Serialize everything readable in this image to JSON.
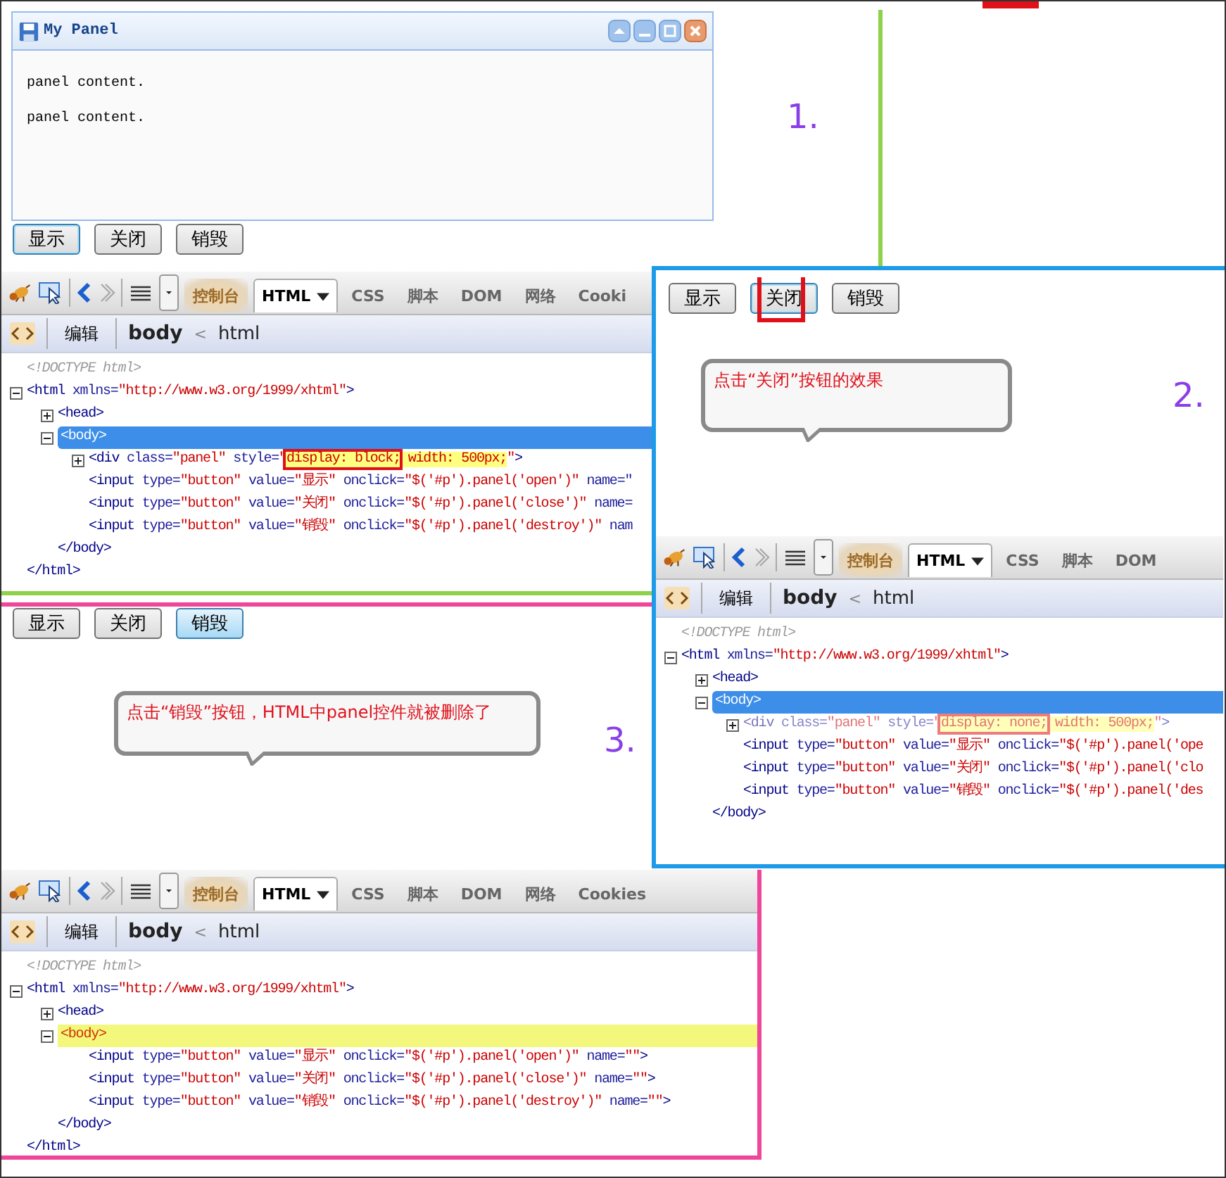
{
  "scenes": [
    {
      "panel": {
        "title": "My Panel",
        "paragraphs": [
          "panel content.",
          "panel content."
        ]
      },
      "buttons": [
        {
          "label": "显示",
          "focused": true,
          "pressed": false,
          "annotated": false
        },
        {
          "label": "关闭",
          "focused": false,
          "pressed": false,
          "annotated": false
        },
        {
          "label": "销毁",
          "focused": false,
          "pressed": false,
          "annotated": false
        }
      ],
      "step": "1.",
      "devtools": {
        "tabs": [
          {
            "label": "控制台",
            "selected": false,
            "glow": true
          },
          {
            "label": "HTML",
            "selected": true,
            "glow": false
          },
          {
            "label": "CSS",
            "selected": false,
            "glow": false
          },
          {
            "label": "脚本",
            "selected": false,
            "glow": false
          },
          {
            "label": "DOM",
            "selected": false,
            "glow": false
          },
          {
            "label": "网络",
            "selected": false,
            "glow": false
          },
          {
            "label": "Cooki",
            "selected": false,
            "glow": false
          }
        ],
        "edit_button": "编辑",
        "crumbs": [
          "body",
          "html"
        ],
        "separator": "<",
        "tree": [
          {
            "tokens": [
              {
                "kind": "comment",
                "text": "<!DOCTYPE html>"
              }
            ],
            "kind": "leaf",
            "selected": false,
            "changed": false,
            "dimmed": false
          },
          {
            "tokens": [
              {
                "kind": "tag",
                "text": "<html "
              },
              {
                "kind": "attr",
                "text": "xmlns="
              },
              {
                "kind": "value",
                "text": "\"http://www.w3.org/1999/xhtml\""
              },
              {
                "kind": "tag",
                "text": ">"
              }
            ],
            "kind": "expanded",
            "selected": false,
            "changed": false,
            "dimmed": false,
            "close": [
              {
                "kind": "tag",
                "text": "</html>"
              }
            ],
            "children": [
              {
                "tokens": [
                  {
                    "kind": "tag",
                    "text": "<head>"
                  }
                ],
                "kind": "collapsed",
                "selected": false,
                "changed": false,
                "dimmed": false
              },
              {
                "tokens": [
                  {
                    "kind": "tag",
                    "text": "<body>"
                  }
                ],
                "kind": "expanded",
                "selected": true,
                "changed": false,
                "dimmed": false,
                "close": [
                  {
                    "kind": "tag",
                    "text": "</body>"
                  }
                ],
                "children": [
                  {
                    "tokens": [
                      {
                        "kind": "tag",
                        "text": "<div "
                      },
                      {
                        "kind": "attr",
                        "text": "class="
                      },
                      {
                        "kind": "value",
                        "text": "\"panel\""
                      },
                      {
                        "kind": "attr",
                        "text": " style="
                      },
                      {
                        "kind": "value",
                        "text": "\""
                      },
                      {
                        "kind": "style-boxed",
                        "text": "display: block;"
                      },
                      {
                        "kind": "style",
                        "text": " width: 500px;"
                      },
                      {
                        "kind": "value",
                        "text": "\""
                      },
                      {
                        "kind": "tag",
                        "text": ">"
                      }
                    ],
                    "kind": "collapsed",
                    "selected": false,
                    "changed": false,
                    "dimmed": false
                  },
                  {
                    "tokens": [
                      {
                        "kind": "tag",
                        "text": "<input "
                      },
                      {
                        "kind": "attr",
                        "text": "type="
                      },
                      {
                        "kind": "value",
                        "text": "\"button\""
                      },
                      {
                        "kind": "attr",
                        "text": " value="
                      },
                      {
                        "kind": "value",
                        "text": "\"显示\""
                      },
                      {
                        "kind": "attr",
                        "text": " onclick="
                      },
                      {
                        "kind": "value",
                        "text": "\"$('#p').panel('open')\""
                      },
                      {
                        "kind": "attr",
                        "text": " name=\""
                      }
                    ],
                    "kind": "leaf",
                    "selected": false,
                    "changed": false,
                    "dimmed": false
                  },
                  {
                    "tokens": [
                      {
                        "kind": "tag",
                        "text": "<input "
                      },
                      {
                        "kind": "attr",
                        "text": "type="
                      },
                      {
                        "kind": "value",
                        "text": "\"button\""
                      },
                      {
                        "kind": "attr",
                        "text": " value="
                      },
                      {
                        "kind": "value",
                        "text": "\"关闭\""
                      },
                      {
                        "kind": "attr",
                        "text": " onclick="
                      },
                      {
                        "kind": "value",
                        "text": "\"$('#p').panel('close')\""
                      },
                      {
                        "kind": "attr",
                        "text": " name="
                      }
                    ],
                    "kind": "leaf",
                    "selected": false,
                    "changed": false,
                    "dimmed": false
                  },
                  {
                    "tokens": [
                      {
                        "kind": "tag",
                        "text": "<input "
                      },
                      {
                        "kind": "attr",
                        "text": "type="
                      },
                      {
                        "kind": "value",
                        "text": "\"button\""
                      },
                      {
                        "kind": "attr",
                        "text": " value="
                      },
                      {
                        "kind": "value",
                        "text": "\"销毁\""
                      },
                      {
                        "kind": "attr",
                        "text": " onclick="
                      },
                      {
                        "kind": "value",
                        "text": "\"$('#p').panel('destroy')\""
                      },
                      {
                        "kind": "attr",
                        "text": " nam"
                      }
                    ],
                    "kind": "leaf",
                    "selected": false,
                    "changed": false,
                    "dimmed": false
                  }
                ]
              }
            ]
          }
        ]
      }
    },
    {
      "buttons": [
        {
          "label": "显示",
          "focused": false,
          "pressed": false,
          "annotated": false
        },
        {
          "label": "关闭",
          "focused": true,
          "pressed": false,
          "annotated": true
        },
        {
          "label": "销毁",
          "focused": false,
          "pressed": false,
          "annotated": false
        }
      ],
      "callout": "点击“关闭”按钮的效果",
      "step": "2.",
      "devtools": {
        "tabs": [
          {
            "label": "控制台",
            "selected": false,
            "glow": true
          },
          {
            "label": "HTML",
            "selected": true,
            "glow": false
          },
          {
            "label": "CSS",
            "selected": false,
            "glow": false
          },
          {
            "label": "脚本",
            "selected": false,
            "glow": false
          },
          {
            "label": "DOM",
            "selected": false,
            "glow": false
          }
        ],
        "edit_button": "编辑",
        "crumbs": [
          "body",
          "html"
        ],
        "separator": "<",
        "tree": [
          {
            "tokens": [
              {
                "kind": "comment",
                "text": "<!DOCTYPE html>"
              }
            ],
            "kind": "leaf",
            "selected": false,
            "changed": false,
            "dimmed": false
          },
          {
            "tokens": [
              {
                "kind": "tag",
                "text": "<html "
              },
              {
                "kind": "attr",
                "text": "xmlns="
              },
              {
                "kind": "value",
                "text": "\"http://www.w3.org/1999/xhtml\""
              },
              {
                "kind": "tag",
                "text": ">"
              }
            ],
            "kind": "expanded",
            "selected": false,
            "changed": false,
            "dimmed": false,
            "children": [
              {
                "tokens": [
                  {
                    "kind": "tag",
                    "text": "<head>"
                  }
                ],
                "kind": "collapsed",
                "selected": false,
                "changed": false,
                "dimmed": false
              },
              {
                "tokens": [
                  {
                    "kind": "tag",
                    "text": "<body>"
                  }
                ],
                "kind": "expanded",
                "selected": true,
                "changed": false,
                "dimmed": false,
                "close": [
                  {
                    "kind": "tag",
                    "text": "</body>"
                  }
                ],
                "children": [
                  {
                    "tokens": [
                      {
                        "kind": "tag",
                        "text": "<div "
                      },
                      {
                        "kind": "attr",
                        "text": "class="
                      },
                      {
                        "kind": "value",
                        "text": "\"panel\""
                      },
                      {
                        "kind": "attr",
                        "text": " style="
                      },
                      {
                        "kind": "value",
                        "text": "\""
                      },
                      {
                        "kind": "style-boxed",
                        "text": "display: none;"
                      },
                      {
                        "kind": "style",
                        "text": " width: 500px;"
                      },
                      {
                        "kind": "value",
                        "text": "\""
                      },
                      {
                        "kind": "tag",
                        "text": ">"
                      }
                    ],
                    "kind": "collapsed",
                    "selected": false,
                    "changed": false,
                    "dimmed": true
                  },
                  {
                    "tokens": [
                      {
                        "kind": "tag",
                        "text": "<input "
                      },
                      {
                        "kind": "attr",
                        "text": "type="
                      },
                      {
                        "kind": "value",
                        "text": "\"button\""
                      },
                      {
                        "kind": "attr",
                        "text": " value="
                      },
                      {
                        "kind": "value",
                        "text": "\"显示\""
                      },
                      {
                        "kind": "attr",
                        "text": " onclick="
                      },
                      {
                        "kind": "value",
                        "text": "\"$('#p').panel('ope"
                      }
                    ],
                    "kind": "leaf",
                    "selected": false,
                    "changed": false,
                    "dimmed": false
                  },
                  {
                    "tokens": [
                      {
                        "kind": "tag",
                        "text": "<input "
                      },
                      {
                        "kind": "attr",
                        "text": "type="
                      },
                      {
                        "kind": "value",
                        "text": "\"button\""
                      },
                      {
                        "kind": "attr",
                        "text": " value="
                      },
                      {
                        "kind": "value",
                        "text": "\"关闭\""
                      },
                      {
                        "kind": "attr",
                        "text": " onclick="
                      },
                      {
                        "kind": "value",
                        "text": "\"$('#p').panel('clo"
                      }
                    ],
                    "kind": "leaf",
                    "selected": false,
                    "changed": false,
                    "dimmed": false
                  },
                  {
                    "tokens": [
                      {
                        "kind": "tag",
                        "text": "<input "
                      },
                      {
                        "kind": "attr",
                        "text": "type="
                      },
                      {
                        "kind": "value",
                        "text": "\"button\""
                      },
                      {
                        "kind": "attr",
                        "text": " value="
                      },
                      {
                        "kind": "value",
                        "text": "\"销毁\""
                      },
                      {
                        "kind": "attr",
                        "text": " onclick="
                      },
                      {
                        "kind": "value",
                        "text": "\"$('#p').panel('des"
                      }
                    ],
                    "kind": "leaf",
                    "selected": false,
                    "changed": false,
                    "dimmed": false
                  }
                ]
              }
            ]
          }
        ]
      }
    },
    {
      "buttons": [
        {
          "label": "显示",
          "focused": false,
          "pressed": false,
          "annotated": false
        },
        {
          "label": "关闭",
          "focused": false,
          "pressed": false,
          "annotated": false
        },
        {
          "label": "销毁",
          "focused": false,
          "pressed": true,
          "annotated": false
        }
      ],
      "callout": "点击“销毁”按钮，HTML中panel控件就被删除了",
      "step": "3.",
      "devtools": {
        "tabs": [
          {
            "label": "控制台",
            "selected": false,
            "glow": true
          },
          {
            "label": "HTML",
            "selected": true,
            "glow": false
          },
          {
            "label": "CSS",
            "selected": false,
            "glow": false
          },
          {
            "label": "脚本",
            "selected": false,
            "glow": false
          },
          {
            "label": "DOM",
            "selected": false,
            "glow": false
          },
          {
            "label": "网络",
            "selected": false,
            "glow": false
          },
          {
            "label": "Cookies",
            "selected": false,
            "glow": false
          }
        ],
        "edit_button": "编辑",
        "crumbs": [
          "body",
          "html"
        ],
        "separator": "<",
        "tree": [
          {
            "tokens": [
              {
                "kind": "comment",
                "text": "<!DOCTYPE html>"
              }
            ],
            "kind": "leaf",
            "selected": false,
            "changed": false,
            "dimmed": false
          },
          {
            "tokens": [
              {
                "kind": "tag",
                "text": "<html "
              },
              {
                "kind": "attr",
                "text": "xmlns="
              },
              {
                "kind": "value",
                "text": "\"http://www.w3.org/1999/xhtml\""
              },
              {
                "kind": "tag",
                "text": ">"
              }
            ],
            "kind": "expanded",
            "selected": false,
            "changed": false,
            "dimmed": false,
            "close": [
              {
                "kind": "tag",
                "text": "</html>"
              }
            ],
            "children": [
              {
                "tokens": [
                  {
                    "kind": "tag",
                    "text": "<head>"
                  }
                ],
                "kind": "collapsed",
                "selected": false,
                "changed": false,
                "dimmed": false
              },
              {
                "tokens": [
                  {
                    "kind": "tag",
                    "text": "<body>"
                  }
                ],
                "kind": "expanded",
                "selected": false,
                "changed": true,
                "dimmed": false,
                "close": [
                  {
                    "kind": "tag",
                    "text": "</body>"
                  }
                ],
                "children": [
                  {
                    "tokens": [
                      {
                        "kind": "tag",
                        "text": "<input "
                      },
                      {
                        "kind": "attr",
                        "text": "type="
                      },
                      {
                        "kind": "value",
                        "text": "\"button\""
                      },
                      {
                        "kind": "attr",
                        "text": " value="
                      },
                      {
                        "kind": "value",
                        "text": "\"显示\""
                      },
                      {
                        "kind": "attr",
                        "text": " onclick="
                      },
                      {
                        "kind": "value",
                        "text": "\"$('#p').panel('open')\""
                      },
                      {
                        "kind": "attr",
                        "text": " name="
                      },
                      {
                        "kind": "value",
                        "text": "\"\""
                      },
                      {
                        "kind": "tag",
                        "text": ">"
                      }
                    ],
                    "kind": "leaf",
                    "selected": false,
                    "changed": false,
                    "dimmed": false
                  },
                  {
                    "tokens": [
                      {
                        "kind": "tag",
                        "text": "<input "
                      },
                      {
                        "kind": "attr",
                        "text": "type="
                      },
                      {
                        "kind": "value",
                        "text": "\"button\""
                      },
                      {
                        "kind": "attr",
                        "text": " value="
                      },
                      {
                        "kind": "value",
                        "text": "\"关闭\""
                      },
                      {
                        "kind": "attr",
                        "text": " onclick="
                      },
                      {
                        "kind": "value",
                        "text": "\"$('#p').panel('close')\""
                      },
                      {
                        "kind": "attr",
                        "text": " name="
                      },
                      {
                        "kind": "value",
                        "text": "\"\""
                      },
                      {
                        "kind": "tag",
                        "text": ">"
                      }
                    ],
                    "kind": "leaf",
                    "selected": false,
                    "changed": false,
                    "dimmed": false
                  },
                  {
                    "tokens": [
                      {
                        "kind": "tag",
                        "text": "<input "
                      },
                      {
                        "kind": "attr",
                        "text": "type="
                      },
                      {
                        "kind": "value",
                        "text": "\"button\""
                      },
                      {
                        "kind": "attr",
                        "text": " value="
                      },
                      {
                        "kind": "value",
                        "text": "\"销毁\""
                      },
                      {
                        "kind": "attr",
                        "text": " onclick="
                      },
                      {
                        "kind": "value",
                        "text": "\"$('#p').panel('destroy')\""
                      },
                      {
                        "kind": "attr",
                        "text": " name="
                      },
                      {
                        "kind": "value",
                        "text": "\"\""
                      },
                      {
                        "kind": "tag",
                        "text": ">"
                      }
                    ],
                    "kind": "leaf",
                    "selected": false,
                    "changed": false,
                    "dimmed": false
                  }
                ]
              }
            ]
          }
        ]
      }
    }
  ]
}
